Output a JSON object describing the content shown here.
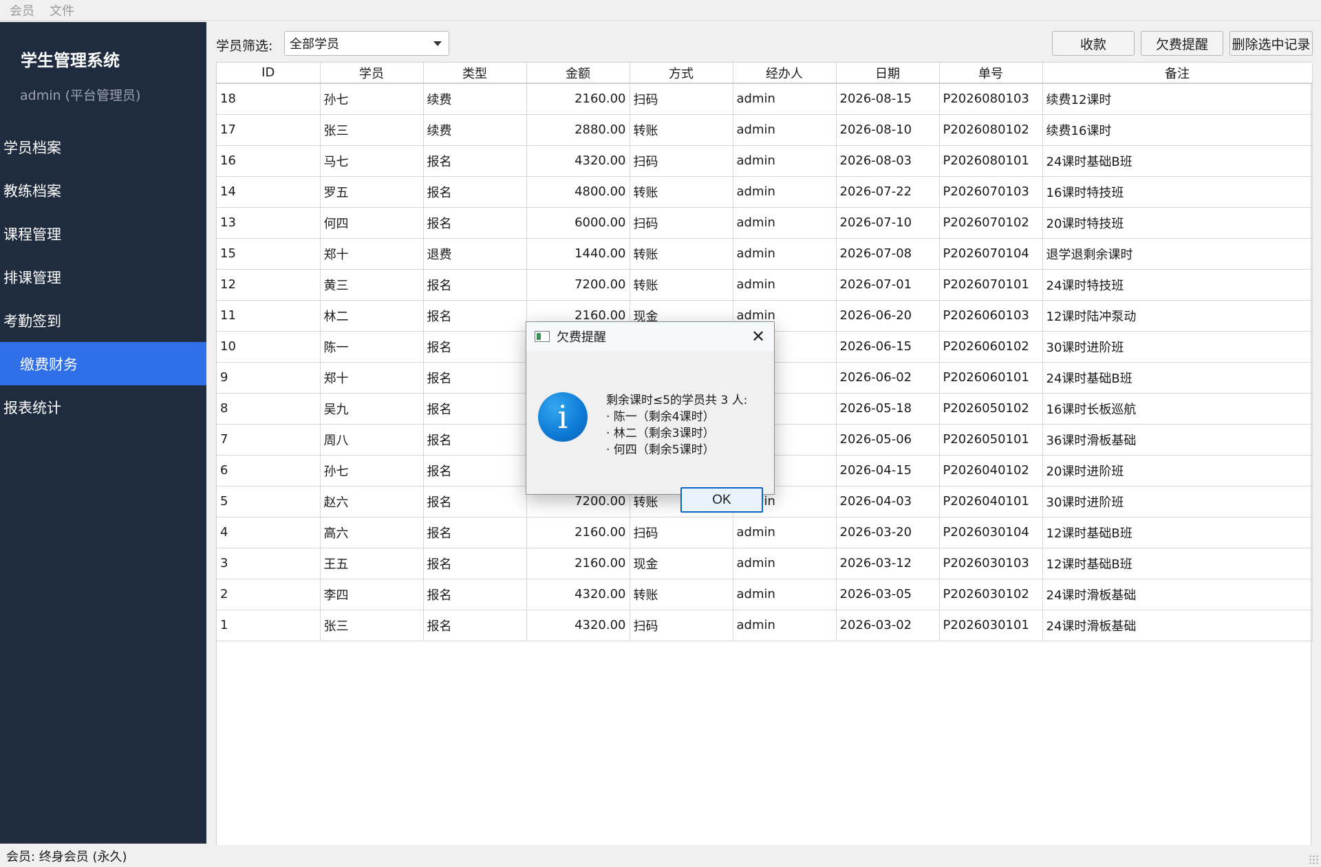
{
  "menubar": {
    "items": [
      "会员",
      "文件"
    ]
  },
  "sidebar": {
    "title": "学生管理系统",
    "subtitle": "admin (平台管理员)",
    "items": [
      {
        "label": "学员档案",
        "active": false
      },
      {
        "label": "教练档案",
        "active": false
      },
      {
        "label": "课程管理",
        "active": false
      },
      {
        "label": "排课管理",
        "active": false
      },
      {
        "label": "考勤签到",
        "active": false
      },
      {
        "label": "缴费财务",
        "active": true
      },
      {
        "label": "报表统计",
        "active": false
      }
    ]
  },
  "toolbar": {
    "filter_label": "学员筛选:",
    "filter_value": "全部学员",
    "collect_label": "收款",
    "remind_label": "欠费提醒",
    "delete_label": "删除选中记录"
  },
  "table": {
    "columns": [
      "ID",
      "学员",
      "类型",
      "金额",
      "方式",
      "经办人",
      "日期",
      "单号",
      "备注"
    ],
    "rows": [
      [
        "18",
        "孙七",
        "续费",
        "2160.00",
        "扫码",
        "admin",
        "2026-08-15",
        "P2026080103",
        "续费12课时"
      ],
      [
        "17",
        "张三",
        "续费",
        "2880.00",
        "转账",
        "admin",
        "2026-08-10",
        "P2026080102",
        "续费16课时"
      ],
      [
        "16",
        "马七",
        "报名",
        "4320.00",
        "扫码",
        "admin",
        "2026-08-03",
        "P2026080101",
        "24课时基础B班"
      ],
      [
        "14",
        "罗五",
        "报名",
        "4800.00",
        "转账",
        "admin",
        "2026-07-22",
        "P2026070103",
        "16课时特技班"
      ],
      [
        "13",
        "何四",
        "报名",
        "6000.00",
        "扫码",
        "admin",
        "2026-07-10",
        "P2026070102",
        "20课时特技班"
      ],
      [
        "15",
        "郑十",
        "退费",
        "1440.00",
        "转账",
        "admin",
        "2026-07-08",
        "P2026070104",
        "退学退剩余课时"
      ],
      [
        "12",
        "黄三",
        "报名",
        "7200.00",
        "转账",
        "admin",
        "2026-07-01",
        "P2026070101",
        "24课时特技班"
      ],
      [
        "11",
        "林二",
        "报名",
        "2160.00",
        "现金",
        "admin",
        "2026-06-20",
        "P2026060103",
        "12课时陆冲泵动"
      ],
      [
        "10",
        "陈一",
        "报名",
        "",
        "",
        "",
        "2026-06-15",
        "P2026060102",
        "30课时进阶班"
      ],
      [
        "9",
        "郑十",
        "报名",
        "",
        "",
        "",
        "2026-06-02",
        "P2026060101",
        "24课时基础B班"
      ],
      [
        "8",
        "吴九",
        "报名",
        "",
        "",
        "",
        "2026-05-18",
        "P2026050102",
        "16课时长板巡航"
      ],
      [
        "7",
        "周八",
        "报名",
        "",
        "",
        "",
        "2026-05-06",
        "P2026050101",
        "36课时滑板基础"
      ],
      [
        "6",
        "孙七",
        "报名",
        "",
        "",
        "",
        "2026-04-15",
        "P2026040102",
        "20课时进阶班"
      ],
      [
        "5",
        "赵六",
        "报名",
        "7200.00",
        "转账",
        "admin",
        "2026-04-03",
        "P2026040101",
        "30课时进阶班"
      ],
      [
        "4",
        "高六",
        "报名",
        "2160.00",
        "扫码",
        "admin",
        "2026-03-20",
        "P2026030104",
        "12课时基础B班"
      ],
      [
        "3",
        "王五",
        "报名",
        "2160.00",
        "现金",
        "admin",
        "2026-03-12",
        "P2026030103",
        "12课时基础B班"
      ],
      [
        "2",
        "李四",
        "报名",
        "4320.00",
        "转账",
        "admin",
        "2026-03-05",
        "P2026030102",
        "24课时滑板基础"
      ],
      [
        "1",
        "张三",
        "报名",
        "4320.00",
        "扫码",
        "admin",
        "2026-03-02",
        "P2026030101",
        "24课时滑板基础"
      ]
    ]
  },
  "dialog": {
    "title": "欠费提醒",
    "lines": [
      "剩余课时≤5的学员共 3 人:",
      "· 陈一（剩余4课时）",
      "· 林二（剩余3课时）",
      "· 何四（剩余5课时）"
    ],
    "ok_label": "OK",
    "close_glyph": "✕",
    "icon_glyph": "i"
  },
  "statusbar": {
    "text": "会员: 终身会员 (永久)"
  },
  "colors": {
    "sidebar_bg": "#1f2b3e",
    "active_nav": "#2f6fe8",
    "info_icon": "#0d79d6"
  }
}
